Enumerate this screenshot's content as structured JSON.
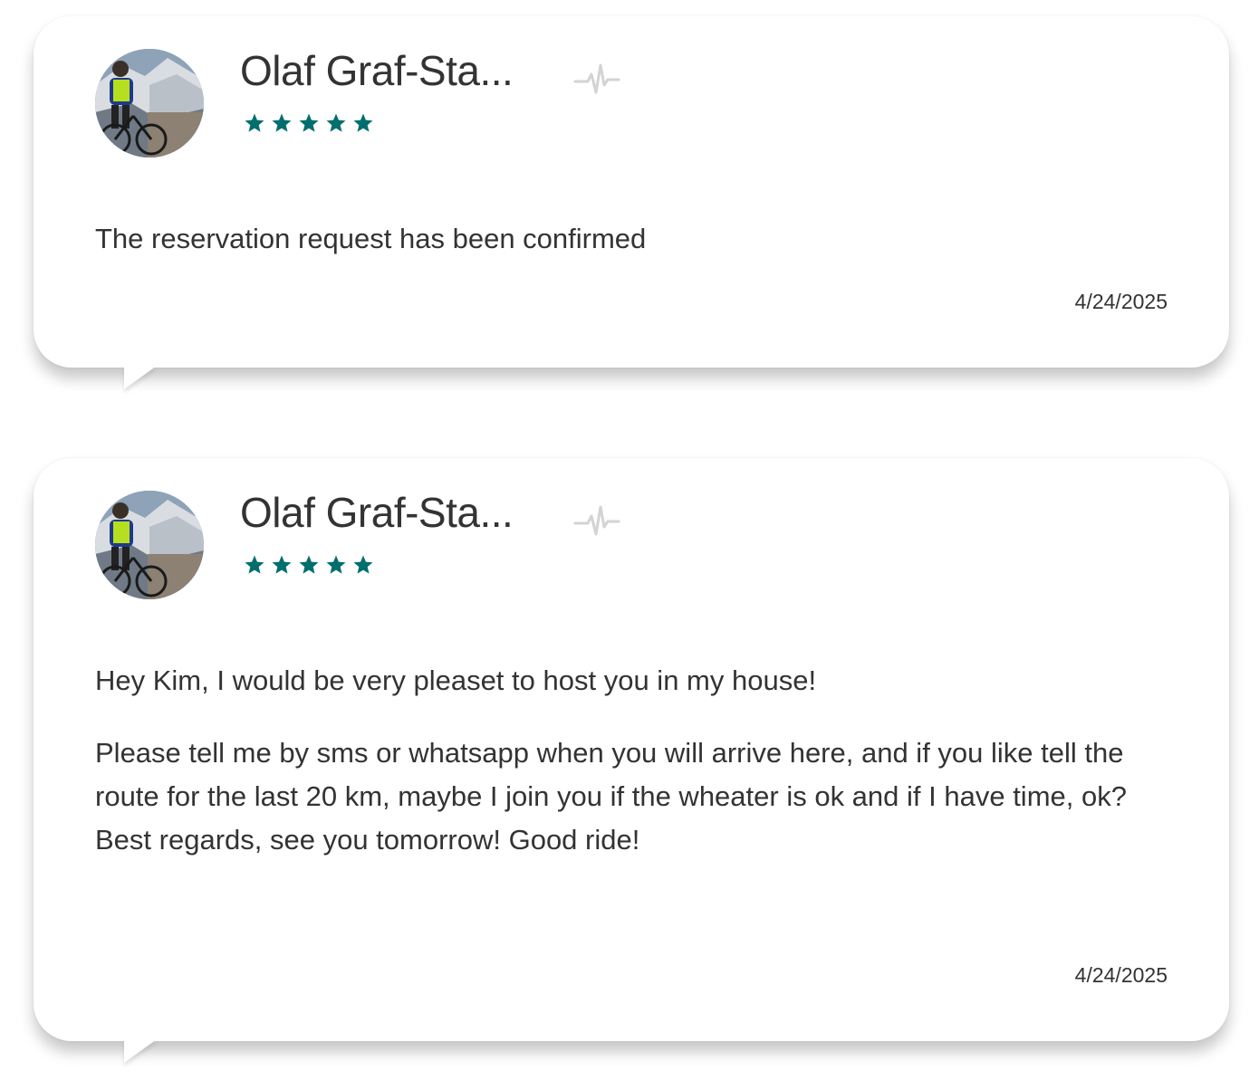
{
  "messages": [
    {
      "sender_name": "Olaf Graf-Sta...",
      "rating": 5,
      "rating_color": "#006e6e",
      "avatar_icon": "cyclist-avatar",
      "status_icon": "pulse-icon",
      "paragraphs": [
        [
          "The reservation request has been confirmed"
        ]
      ],
      "date": "4/24/2025"
    },
    {
      "sender_name": "Olaf Graf-Sta...",
      "rating": 5,
      "rating_color": "#006e6e",
      "avatar_icon": "cyclist-avatar",
      "status_icon": "pulse-icon",
      "paragraphs": [
        [
          "Hey Kim, I would be very pleaset to host you in my house!"
        ],
        [
          "Please tell me by sms or whatsapp when you will arrive here, and if you like tell the route for the last 20 km, maybe I join you if the wheater is ok and if I have time, ok?",
          "Best regards, see you tomorrow! Good ride!"
        ]
      ],
      "date": "4/24/2025"
    }
  ]
}
